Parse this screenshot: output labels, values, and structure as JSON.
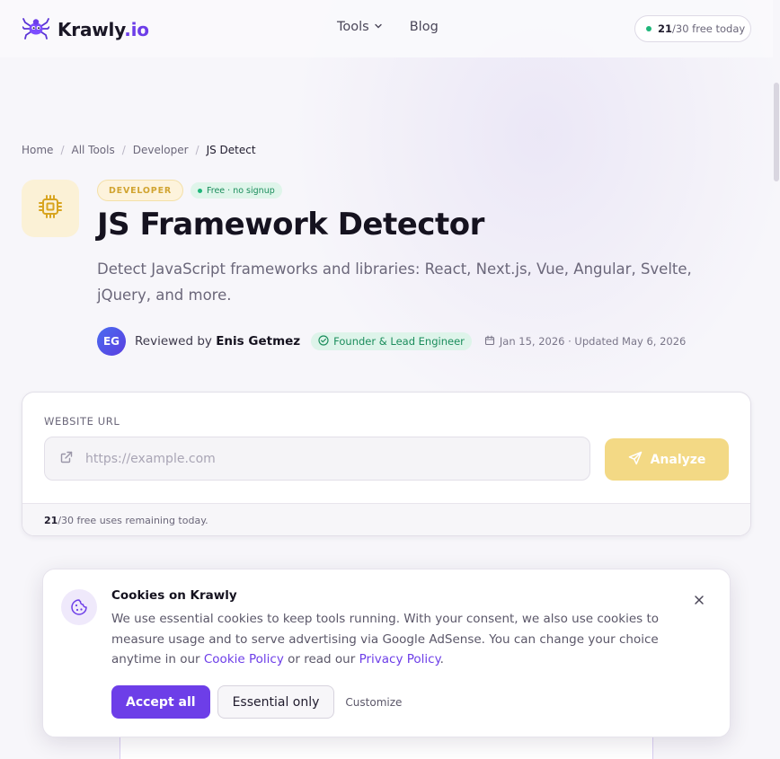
{
  "header": {
    "logo_text": "Krawly",
    "logo_tld": ".io",
    "nav": [
      {
        "label": "Tools",
        "has_dropdown": true
      },
      {
        "label": "Blog",
        "has_dropdown": false
      }
    ],
    "quota": {
      "used": "21",
      "rest": "/30 free today"
    }
  },
  "breadcrumb": {
    "items": [
      "Home",
      "All Tools",
      "Developer"
    ],
    "current": "JS Detect",
    "separator": "/"
  },
  "hero": {
    "category_badge": "DEVELOPER",
    "free_badge": "Free · no signup",
    "title": "JS Framework Detector",
    "subtitle": "Detect JavaScript frameworks and libraries: React, Next.js, Vue, Angular, Svelte, jQuery, and more.",
    "reviewer": {
      "initials": "EG",
      "prefix": "Reviewed by",
      "name": "Enis Getmez",
      "role": "Founder & Lead Engineer",
      "dates": "Jan 15, 2026 · Updated May 6, 2026"
    }
  },
  "tool_card": {
    "label": "WEBSITE URL",
    "input_value": "",
    "input_placeholder": "https://example.com",
    "analyze_label": "Analyze",
    "remaining_count": "21",
    "remaining_text": "/30 free uses remaining today."
  },
  "cookie_banner": {
    "title": "Cookies on Krawly",
    "text_before": "We use essential cookies to keep tools running. With your consent, we also use cookies to measure usage and to serve advertising via Google AdSense. You can change your choice anytime in our ",
    "cookie_policy_link": "Cookie Policy",
    "text_middle": " or read our ",
    "privacy_policy_link": "Privacy Policy",
    "text_after": ".",
    "accept_label": "Accept all",
    "essential_label": "Essential only",
    "customize_label": "Customize"
  },
  "colors": {
    "brand": "#6d3ee8",
    "accent_yellow": "#f3d985",
    "green": "#1fb67a"
  },
  "icons": {
    "logo": "spider-icon",
    "tool": "chip-icon",
    "input": "external-link-icon",
    "analyze": "send-icon",
    "cookie": "cookie-icon",
    "close": "close-icon"
  }
}
